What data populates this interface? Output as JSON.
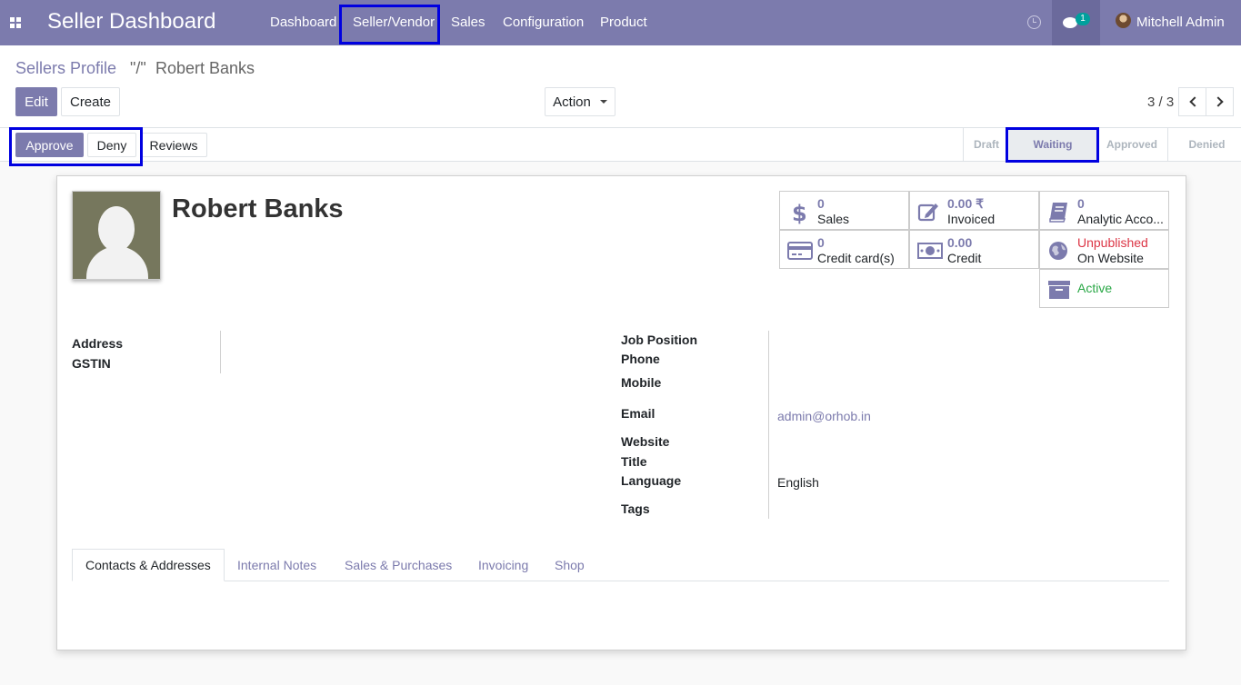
{
  "navbar": {
    "brand": "Seller Dashboard",
    "menu": [
      "Dashboard",
      "Seller/Vendor",
      "Sales",
      "Configuration",
      "Product"
    ],
    "chat_badge": "1",
    "user": "Mitchell Admin"
  },
  "breadcrumb": {
    "parent": "Sellers Profile",
    "separator": "\"/\"",
    "current": "Robert Banks"
  },
  "buttons": {
    "edit": "Edit",
    "create": "Create",
    "action": "Action",
    "approve": "Approve",
    "deny": "Deny",
    "reviews": "Reviews"
  },
  "pager": {
    "value": "3 / 3"
  },
  "stages": [
    "Draft",
    "Waiting",
    "Approved",
    "Denied"
  ],
  "active_stage": "Waiting",
  "record": {
    "name": "Robert Banks"
  },
  "smart_buttons": {
    "sales": {
      "value": "0",
      "label": "Sales",
      "icon": "dollar-icon"
    },
    "invoiced": {
      "value": "0.00 ₹",
      "label": "Invoiced",
      "icon": "edit-icon"
    },
    "analytic": {
      "value": "0",
      "label": "Analytic Acco...",
      "icon": "book-icon"
    },
    "credit_cards": {
      "value": "0",
      "label": "Credit card(s)",
      "icon": "credit-card-icon"
    },
    "credit": {
      "value": "0.00",
      "label": "Credit",
      "icon": "money-icon"
    },
    "website": {
      "value": "Unpublished",
      "label": "On Website",
      "icon": "globe-icon"
    },
    "active": {
      "label": "Active",
      "icon": "archive-icon"
    }
  },
  "fields_left": {
    "address": "Address",
    "gstin": "GSTIN"
  },
  "fields_right": {
    "job_position": "Job Position",
    "phone": "Phone",
    "mobile": "Mobile",
    "email": "Email",
    "email_value": "admin@orhob.in",
    "website": "Website",
    "title": "Title",
    "language": "Language",
    "language_value": "English",
    "tags": "Tags"
  },
  "tabs": [
    "Contacts & Addresses",
    "Internal Notes",
    "Sales & Purchases",
    "Invoicing",
    "Shop"
  ],
  "colors": {
    "brand": "#7c7bad",
    "highlight": "#0000e0",
    "danger": "#dc3545",
    "success": "#28a745"
  }
}
